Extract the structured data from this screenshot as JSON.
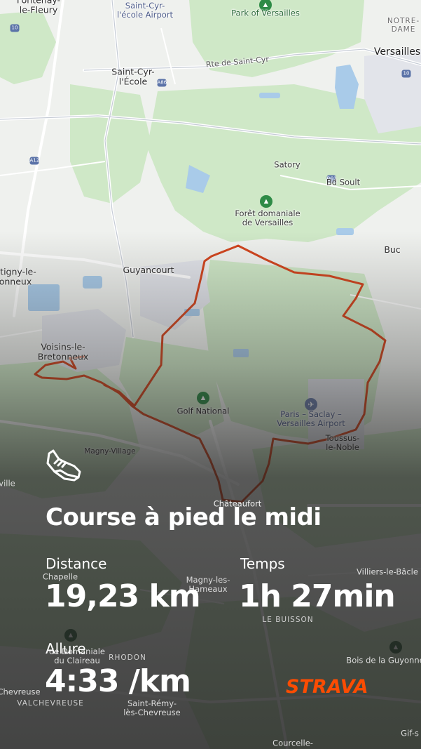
{
  "map": {
    "labels": [
      {
        "id": "fontenay",
        "text": "Fontenay-\nle-Fleury",
        "kind": "town"
      },
      {
        "id": "saint-cyr-airport",
        "text": "Saint-Cyr-\nl'école Airport",
        "kind": "air"
      },
      {
        "id": "park-versailles",
        "text": "Park of Versailles",
        "kind": "poi"
      },
      {
        "id": "notre-dame",
        "text": "NOTRE-\nDAME",
        "kind": "caps"
      },
      {
        "id": "versailles",
        "text": "Versailles",
        "kind": "big"
      },
      {
        "id": "rte-saint-cyr",
        "text": "Rte de Saint-Cyr",
        "kind": "road"
      },
      {
        "id": "saint-cyr",
        "text": "Saint-Cyr-\nl'École",
        "kind": "town"
      },
      {
        "id": "satory",
        "text": "Satory",
        "kind": "label"
      },
      {
        "id": "bd-soult",
        "text": "Bd Soult",
        "kind": "label"
      },
      {
        "id": "foret-versailles",
        "text": "Forêt domaniale\nde Versailles",
        "kind": "label"
      },
      {
        "id": "buc",
        "text": "Buc",
        "kind": "town"
      },
      {
        "id": "montigny",
        "text": "ntigny-le-\nonneux",
        "kind": "town"
      },
      {
        "id": "guyancourt",
        "text": "Guyancourt",
        "kind": "town"
      },
      {
        "id": "voisins",
        "text": "Voisins-le-\nBretonneux",
        "kind": "town"
      },
      {
        "id": "golf-national",
        "text": "Golf National",
        "kind": "label"
      },
      {
        "id": "paris-saclay",
        "text": "Paris – Saclay –\nVersailles Airport",
        "kind": "air"
      },
      {
        "id": "toussus",
        "text": "Toussus-\nle-Noble",
        "kind": "town"
      },
      {
        "id": "magny-village",
        "text": "Magny-Village",
        "kind": "label"
      },
      {
        "id": "ville",
        "text": "ville",
        "kind": "dark"
      },
      {
        "id": "chateaufort",
        "text": "Châteaufort",
        "kind": "dark"
      },
      {
        "id": "villiers",
        "text": "Villiers-le-Bâcle",
        "kind": "dark"
      },
      {
        "id": "chapelle",
        "text": "Chapelle",
        "kind": "dark"
      },
      {
        "id": "magny-hameaux",
        "text": "Magny-les-\nHameaux",
        "kind": "dark"
      },
      {
        "id": "le-buisson",
        "text": "LE BUISSON",
        "kind": "darkcaps"
      },
      {
        "id": "claireau",
        "text": "de Domaniale\ndu Claireau",
        "kind": "dark"
      },
      {
        "id": "rhodon",
        "text": "RHODON",
        "kind": "darkcaps"
      },
      {
        "id": "bois-guyonne",
        "text": "Bois de la Guyonne",
        "kind": "dark"
      },
      {
        "id": "chevreuse",
        "text": "Chevreuse",
        "kind": "dark"
      },
      {
        "id": "valchevreuse",
        "text": "VALCHEVREUSE",
        "kind": "darkcaps"
      },
      {
        "id": "saint-remy",
        "text": "Saint-Rémy-\nlès-Chevreuse",
        "kind": "dark"
      },
      {
        "id": "gif",
        "text": "Gif-s",
        "kind": "dark"
      },
      {
        "id": "courcelle",
        "text": "Courcelle-",
        "kind": "dark"
      }
    ],
    "shields": [
      "10",
      "10",
      "A86",
      "A12",
      "D91"
    ],
    "route_color": "#d2451e"
  },
  "activity": {
    "title": "Course à pied le midi",
    "distance_label": "Distance",
    "distance_value": "19,23 km",
    "time_label": "Temps",
    "time_value": "1h 27min",
    "pace_label": "Allure",
    "pace_value": "4:33 /km",
    "icon": "running-shoe-icon"
  },
  "brand": {
    "name": "STRAVA",
    "color": "#fc4c02"
  }
}
